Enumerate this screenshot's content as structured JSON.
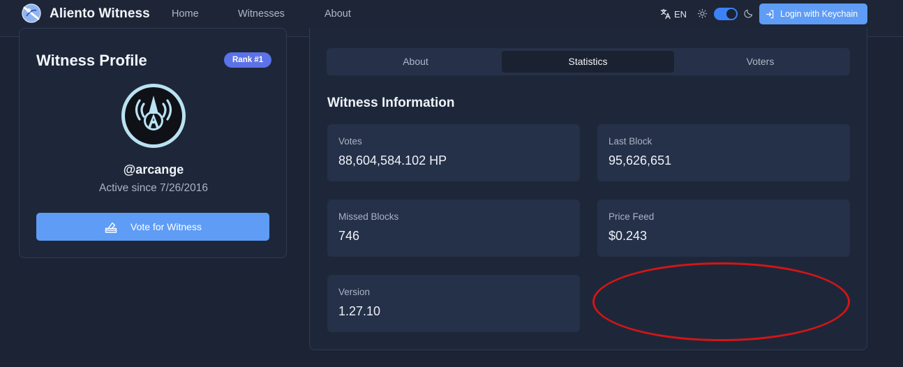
{
  "header": {
    "brand": "Aliento Witness",
    "nav": [
      {
        "label": "Home"
      },
      {
        "label": "Witnesses"
      },
      {
        "label": "About"
      }
    ],
    "language": "EN",
    "theme_toggle": {
      "dark_mode": true
    },
    "login_label": "Login with Keychain",
    "icons": [
      "logo-icon",
      "translate-icon",
      "sun-icon",
      "moon-icon",
      "login-icon"
    ]
  },
  "profile": {
    "title": "Witness Profile",
    "rank": "Rank #1",
    "username": "@arcange",
    "active_since": "Active since 7/26/2016",
    "vote_label": "Vote for Witness",
    "icons": [
      "avatar",
      "ballot-icon"
    ]
  },
  "stats": {
    "tabs": [
      {
        "label": "About",
        "active": false
      },
      {
        "label": "Statistics",
        "active": true
      },
      {
        "label": "Voters",
        "active": false
      }
    ],
    "section_title": "Witness Information",
    "items": [
      {
        "label": "Votes",
        "value": "88,604,584.102 HP"
      },
      {
        "label": "Last Block",
        "value": "95,626,651"
      },
      {
        "label": "Missed Blocks",
        "value": "746"
      },
      {
        "label": "Price Feed",
        "value": "$0.243"
      },
      {
        "label": "Version",
        "value": "1.27.10"
      }
    ]
  },
  "colors": {
    "background": "#1b2334",
    "card": "#1e2739",
    "stat_card": "#253049",
    "accent": "#5e9cf6",
    "badge": "#5b72e8",
    "annotation": "#d41515"
  }
}
